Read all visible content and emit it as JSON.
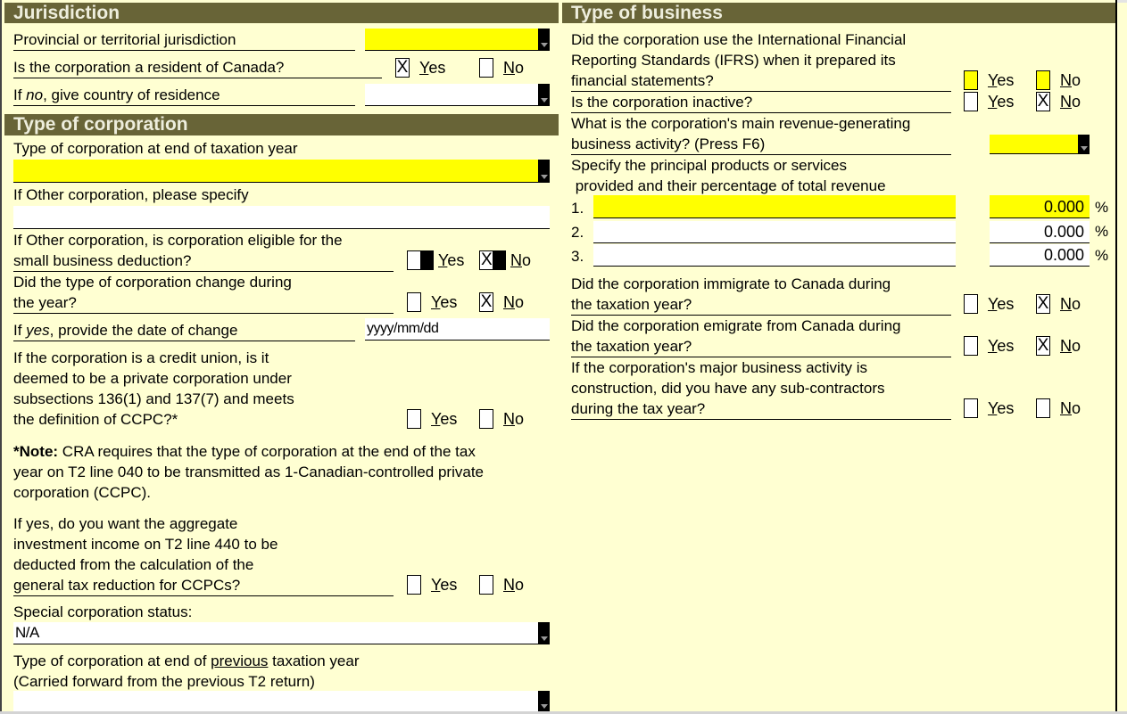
{
  "jurisdiction": {
    "header": "Jurisdiction",
    "provincial_label": "Provincial or territorial jurisdiction",
    "provincial_value": "",
    "resident_label": "Is the corporation a resident of Canada?",
    "resident_yes": true,
    "resident_no": false,
    "country_label_pre": "If ",
    "country_label_em": "no",
    "country_label_post": ", give country of residence",
    "country_value": ""
  },
  "corporation": {
    "header": "Type of corporation",
    "type_end_label": "Type of corporation at end of taxation year",
    "type_end_value": "",
    "other_specify_label": "If Other corporation, please specify",
    "other_specify_value": "",
    "sbd_label_1": "If Other corporation, is corporation eligible for the",
    "sbd_label_2": "small business deduction?",
    "sbd_yes": false,
    "sbd_no": true,
    "changed_label_1": "Did the type of corporation change during",
    "changed_label_2": "the year?",
    "changed_yes": false,
    "changed_no": true,
    "date_label_pre": "If ",
    "date_label_em": "yes",
    "date_label_post": ", provide the date of change",
    "date_placeholder": "yyyy/mm/dd",
    "credit_union_lines": [
      "If the corporation is a credit union, is it",
      "deemed to be a private corporation under",
      "subsections 136(1) and 137(7) and meets",
      "the definition of CCPC?*"
    ],
    "credit_union_yes": false,
    "credit_union_no": false,
    "note_bold": "*Note:",
    "note_lines": [
      " CRA requires that the type of corporation at the end of the tax",
      "year on T2 line 040 to be transmitted as 1-Canadian-controlled private",
      "corporation (CCPC)."
    ],
    "aggregate_lines": [
      "If yes, do you want the aggregate",
      "investment income on T2 line 440 to be",
      "deducted from the calculation of the",
      "general tax reduction for CCPCs?"
    ],
    "aggregate_yes": false,
    "aggregate_no": false,
    "special_status_label": "Special corporation status:",
    "special_status_value": "N/A",
    "prev_type_label_pre": "Type of corporation at end of ",
    "prev_type_label_u": "previous",
    "prev_type_label_post": " taxation year",
    "prev_type_label_2": "(Carried forward from the previous T2 return)",
    "prev_type_value": ""
  },
  "business": {
    "header": "Type of business",
    "ifrs_lines": [
      "Did the corporation use the International Financial",
      "Reporting Standards (IFRS) when it prepared its",
      "financial statements?"
    ],
    "ifrs_yes": false,
    "ifrs_no": false,
    "inactive_label": "Is the corporation inactive?",
    "inactive_yes": false,
    "inactive_no": true,
    "activity_lines": [
      "What is the corporation's main revenue-generating",
      "business activity? (Press F6)"
    ],
    "activity_value": "",
    "products_lines": [
      "Specify the principal products or services",
      " provided and their percentage of total revenue"
    ],
    "products": [
      {
        "num": "1.",
        "value": "",
        "percent": "0.000"
      },
      {
        "num": "2.",
        "value": "",
        "percent": "0.000"
      },
      {
        "num": "3.",
        "value": "",
        "percent": "0.000"
      }
    ],
    "percent_sign": "%",
    "immigrate_lines": [
      "Did the corporation immigrate to Canada during",
      "the taxation year?"
    ],
    "immigrate_yes": false,
    "immigrate_no": true,
    "emigrate_lines": [
      "Did the corporation emigrate from Canada during",
      "the taxation year?"
    ],
    "emigrate_yes": false,
    "emigrate_no": true,
    "subcontract_lines": [
      "If the corporation's major business activity is",
      "construction, did you have any sub-contractors",
      "during the tax year?"
    ],
    "subcontract_yes": false,
    "subcontract_no": false
  },
  "options": {
    "yes_first": "Y",
    "yes_rest": "es",
    "no_first": "N",
    "no_rest": "o",
    "check_mark": "X"
  }
}
